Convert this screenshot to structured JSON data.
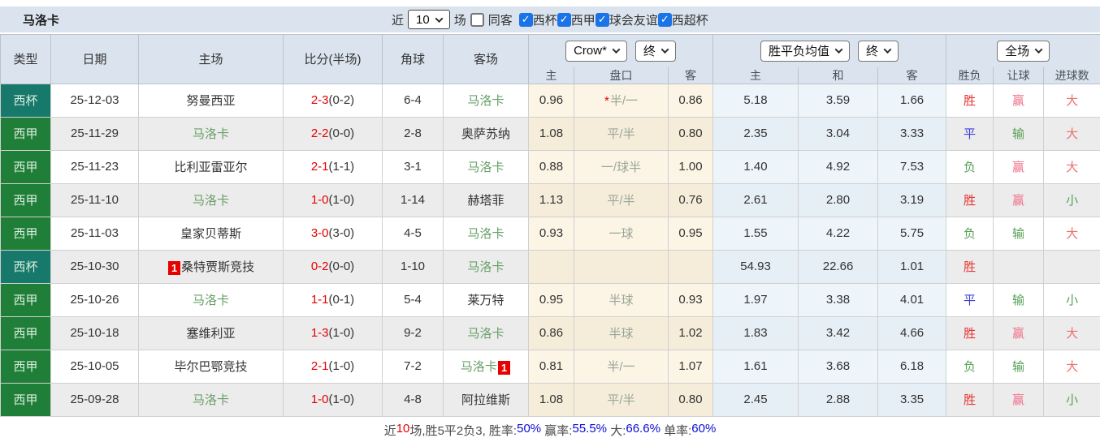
{
  "title": "马洛卡",
  "filters": {
    "recent_label": "近",
    "recent_value": "10",
    "matches_label": "场",
    "same_venue_label": "同客",
    "same_venue_checked": false,
    "leagues": [
      {
        "label": "西杯",
        "checked": true
      },
      {
        "label": "西甲",
        "checked": true
      },
      {
        "label": "球会友谊",
        "checked": true
      },
      {
        "label": "西超杯",
        "checked": true
      }
    ]
  },
  "header": {
    "static_cols": [
      "类型",
      "日期",
      "主场",
      "比分(半场)",
      "角球",
      "客场"
    ],
    "bookmaker_select": "Crow*",
    "asia_time_select": "终",
    "euro_company_select": "胜平负均值",
    "euro_time_select": "终",
    "scope_select": "全场",
    "sub_cols": [
      "主",
      "盘口",
      "客",
      "主",
      "和",
      "客",
      "胜负",
      "让球",
      "进球数"
    ]
  },
  "icons": {
    "dropdown": "chevron-down-icon",
    "checked_box": "check-icon"
  },
  "colors": {
    "header_bg": "#dbe4ee",
    "cup_badge": "#17796c",
    "league_badge": "#1f7e38",
    "score_red": "#e60000",
    "team_green": "#68a068",
    "asia_col_bg": "#fcf4e5",
    "euro_col_bg": "#edf5fb",
    "checkbox_blue": "#1a73e8",
    "result_red": "#e73434",
    "result_pink": "#f0718a",
    "result_salmon": "#ef6e6e",
    "result_blue": "#3d3ddd",
    "result_green": "#55a055",
    "summary_blue": "#0b0bd6"
  },
  "rows": [
    {
      "type": "西杯",
      "type_style": "cup",
      "date": "25-12-03",
      "home": "努曼西亚",
      "home_green": false,
      "home_badge": "",
      "score": "2-3",
      "half": "(0-2)",
      "corner": "6-4",
      "away": "马洛卡",
      "away_green": true,
      "away_badge": "",
      "asia_home": "0.96",
      "handicap_star": "*",
      "handicap": "半/一",
      "asia_away": "0.86",
      "euro_home": "5.18",
      "euro_draw": "3.59",
      "euro_away": "1.66",
      "result": {
        "text": "胜",
        "color": "red"
      },
      "handicap_result": {
        "text": "赢",
        "color": "pink"
      },
      "goals_result": {
        "text": "大",
        "color": "salmon"
      }
    },
    {
      "type": "西甲",
      "type_style": "league",
      "date": "25-11-29",
      "home": "马洛卡",
      "home_green": true,
      "home_badge": "",
      "score": "2-2",
      "half": "(0-0)",
      "corner": "2-8",
      "away": "奥萨苏纳",
      "away_green": false,
      "away_badge": "",
      "asia_home": "1.08",
      "handicap_star": "",
      "handicap": "平/半",
      "asia_away": "0.80",
      "euro_home": "2.35",
      "euro_draw": "3.04",
      "euro_away": "3.33",
      "result": {
        "text": "平",
        "color": "blue"
      },
      "handicap_result": {
        "text": "输",
        "color": "green"
      },
      "goals_result": {
        "text": "大",
        "color": "salmon"
      }
    },
    {
      "type": "西甲",
      "type_style": "league",
      "date": "25-11-23",
      "home": "比利亚雷亚尔",
      "home_green": false,
      "home_badge": "",
      "score": "2-1",
      "half": "(1-1)",
      "corner": "3-1",
      "away": "马洛卡",
      "away_green": true,
      "away_badge": "",
      "asia_home": "0.88",
      "handicap_star": "",
      "handicap": "一/球半",
      "asia_away": "1.00",
      "euro_home": "1.40",
      "euro_draw": "4.92",
      "euro_away": "7.53",
      "result": {
        "text": "负",
        "color": "green"
      },
      "handicap_result": {
        "text": "赢",
        "color": "pink"
      },
      "goals_result": {
        "text": "大",
        "color": "salmon"
      }
    },
    {
      "type": "西甲",
      "type_style": "league",
      "date": "25-11-10",
      "home": "马洛卡",
      "home_green": true,
      "home_badge": "",
      "score": "1-0",
      "half": "(1-0)",
      "corner": "1-14",
      "away": "赫塔菲",
      "away_green": false,
      "away_badge": "",
      "asia_home": "1.13",
      "handicap_star": "",
      "handicap": "平/半",
      "asia_away": "0.76",
      "euro_home": "2.61",
      "euro_draw": "2.80",
      "euro_away": "3.19",
      "result": {
        "text": "胜",
        "color": "red"
      },
      "handicap_result": {
        "text": "赢",
        "color": "pink"
      },
      "goals_result": {
        "text": "小",
        "color": "green"
      }
    },
    {
      "type": "西甲",
      "type_style": "league",
      "date": "25-11-03",
      "home": "皇家贝蒂斯",
      "home_green": false,
      "home_badge": "",
      "score": "3-0",
      "half": "(3-0)",
      "corner": "4-5",
      "away": "马洛卡",
      "away_green": true,
      "away_badge": "",
      "asia_home": "0.93",
      "handicap_star": "",
      "handicap": "一球",
      "asia_away": "0.95",
      "euro_home": "1.55",
      "euro_draw": "4.22",
      "euro_away": "5.75",
      "result": {
        "text": "负",
        "color": "green"
      },
      "handicap_result": {
        "text": "输",
        "color": "green"
      },
      "goals_result": {
        "text": "大",
        "color": "salmon"
      }
    },
    {
      "type": "西杯",
      "type_style": "cup",
      "date": "25-10-30",
      "home": "桑特贾斯竞技",
      "home_green": false,
      "home_badge": "1",
      "score": "0-2",
      "half": "(0-0)",
      "corner": "1-10",
      "away": "马洛卡",
      "away_green": true,
      "away_badge": "",
      "asia_home": "",
      "handicap_star": "",
      "handicap": "",
      "asia_away": "",
      "euro_home": "54.93",
      "euro_draw": "22.66",
      "euro_away": "1.01",
      "result": {
        "text": "胜",
        "color": "red"
      },
      "handicap_result": {
        "text": "",
        "color": "plain"
      },
      "goals_result": {
        "text": "",
        "color": "plain"
      }
    },
    {
      "type": "西甲",
      "type_style": "league",
      "date": "25-10-26",
      "home": "马洛卡",
      "home_green": true,
      "home_badge": "",
      "score": "1-1",
      "half": "(0-1)",
      "corner": "5-4",
      "away": "莱万特",
      "away_green": false,
      "away_badge": "",
      "asia_home": "0.95",
      "handicap_star": "",
      "handicap": "半球",
      "asia_away": "0.93",
      "euro_home": "1.97",
      "euro_draw": "3.38",
      "euro_away": "4.01",
      "result": {
        "text": "平",
        "color": "blue"
      },
      "handicap_result": {
        "text": "输",
        "color": "green"
      },
      "goals_result": {
        "text": "小",
        "color": "green"
      }
    },
    {
      "type": "西甲",
      "type_style": "league",
      "date": "25-10-18",
      "home": "塞维利亚",
      "home_green": false,
      "home_badge": "",
      "score": "1-3",
      "half": "(1-0)",
      "corner": "9-2",
      "away": "马洛卡",
      "away_green": true,
      "away_badge": "",
      "asia_home": "0.86",
      "handicap_star": "",
      "handicap": "半球",
      "asia_away": "1.02",
      "euro_home": "1.83",
      "euro_draw": "3.42",
      "euro_away": "4.66",
      "result": {
        "text": "胜",
        "color": "red"
      },
      "handicap_result": {
        "text": "赢",
        "color": "pink"
      },
      "goals_result": {
        "text": "大",
        "color": "salmon"
      }
    },
    {
      "type": "西甲",
      "type_style": "league",
      "date": "25-10-05",
      "home": "毕尔巴鄂竞技",
      "home_green": false,
      "home_badge": "",
      "score": "2-1",
      "half": "(1-0)",
      "corner": "7-2",
      "away": "马洛卡",
      "away_green": true,
      "away_badge": "1",
      "asia_home": "0.81",
      "handicap_star": "",
      "handicap": "半/一",
      "asia_away": "1.07",
      "euro_home": "1.61",
      "euro_draw": "3.68",
      "euro_away": "6.18",
      "result": {
        "text": "负",
        "color": "green"
      },
      "handicap_result": {
        "text": "输",
        "color": "green"
      },
      "goals_result": {
        "text": "大",
        "color": "salmon"
      }
    },
    {
      "type": "西甲",
      "type_style": "league",
      "date": "25-09-28",
      "home": "马洛卡",
      "home_green": true,
      "home_badge": "",
      "score": "1-0",
      "half": "(1-0)",
      "corner": "4-8",
      "away": "阿拉维斯",
      "away_green": false,
      "away_badge": "",
      "asia_home": "1.08",
      "handicap_star": "",
      "handicap": "平/半",
      "asia_away": "0.80",
      "euro_home": "2.45",
      "euro_draw": "2.88",
      "euro_away": "3.35",
      "result": {
        "text": "胜",
        "color": "red"
      },
      "handicap_result": {
        "text": "赢",
        "color": "pink"
      },
      "goals_result": {
        "text": "小",
        "color": "green"
      }
    }
  ],
  "summary": {
    "segments": [
      {
        "text": "近",
        "color": "plain"
      },
      {
        "text": "10",
        "color": "red"
      },
      {
        "text": "场,胜5平2负3, 胜率:",
        "color": "plain"
      },
      {
        "text": "50%",
        "color": "blue"
      },
      {
        "text": " 赢率:",
        "color": "plain"
      },
      {
        "text": "55.5%",
        "color": "blue"
      },
      {
        "text": " 大:",
        "color": "plain"
      },
      {
        "text": "66.6%",
        "color": "blue"
      },
      {
        "text": " 单率:",
        "color": "plain"
      },
      {
        "text": "60%",
        "color": "blue"
      }
    ]
  }
}
